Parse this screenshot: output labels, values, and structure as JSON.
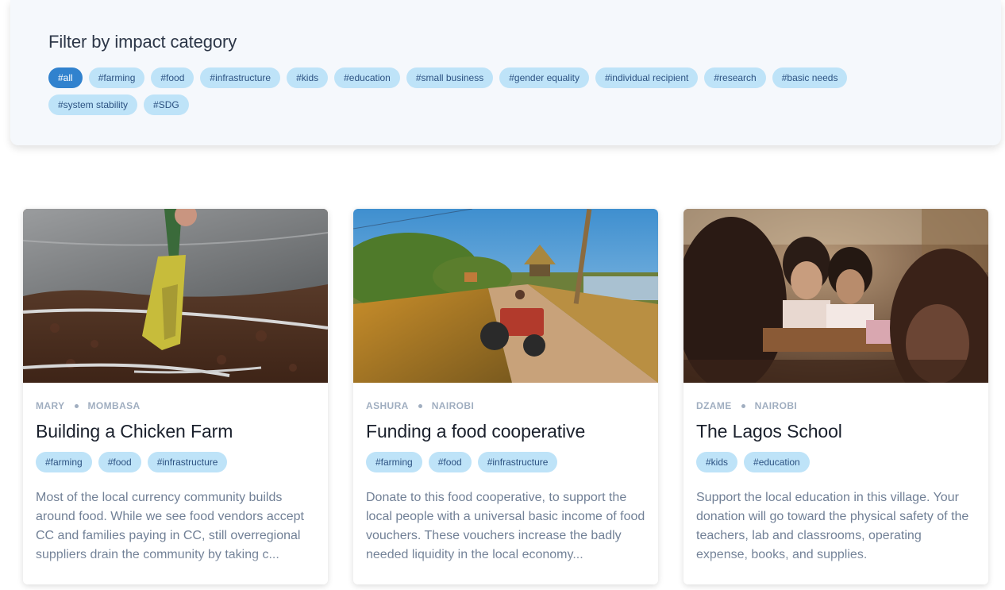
{
  "filter": {
    "title": "Filter by impact category",
    "tags": [
      "#all",
      "#farming",
      "#food",
      "#infrastructure",
      "#kids",
      "#education",
      "#small business",
      "#gender equality",
      "#individual recipient",
      "#research",
      "#basic needs",
      "#system stability",
      "#SDG"
    ]
  },
  "cards": [
    {
      "name": "MARY",
      "location": "MOMBASA",
      "title": "Building a Chicken Farm",
      "tags": [
        "#farming",
        "#food",
        "#infrastructure"
      ],
      "description": "Most of the local currency community builds around food. While we see food vendors accept CC and families paying in CC, still overregional suppliers drain the community by taking c..."
    },
    {
      "name": "ASHURA",
      "location": "NAIROBI",
      "title": "Funding a food cooperative",
      "tags": [
        "#farming",
        "#food",
        "#infrastructure"
      ],
      "description": "Donate to this food cooperative, to support the local people with a universal basic income of food vouchers. These vouchers increase the badly needed liquidity in the local economy..."
    },
    {
      "name": "DZAME",
      "location": "NAIROBI",
      "title": "The Lagos School",
      "tags": [
        "#kids",
        "#education"
      ],
      "description": "Support the local education in this village. Your donation will go toward the physical safety of the teachers, lab and classrooms, operating expense, books, and supplies."
    }
  ],
  "colors": {
    "tag_bg": "#bee3f8",
    "tag_text": "#2c5282",
    "tag_active_bg": "#3182ce"
  }
}
